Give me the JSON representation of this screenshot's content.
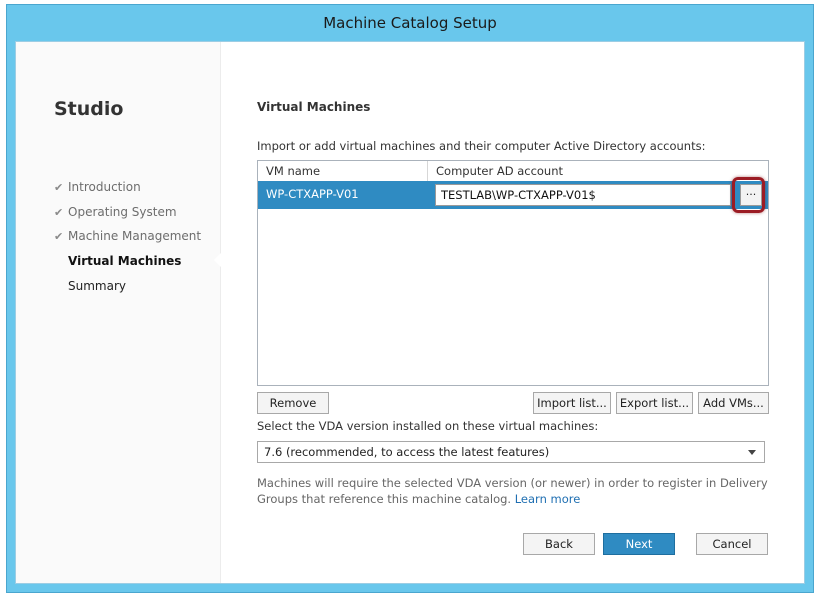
{
  "window": {
    "title": "Machine Catalog Setup"
  },
  "sidebar": {
    "heading": "Studio",
    "steps": [
      {
        "label": "Introduction",
        "state": "done"
      },
      {
        "label": "Operating System",
        "state": "done"
      },
      {
        "label": "Machine Management",
        "state": "done"
      },
      {
        "label": "Virtual Machines",
        "state": "current"
      },
      {
        "label": "Summary",
        "state": "future"
      }
    ],
    "check_glyph": "✔"
  },
  "main": {
    "title": "Virtual Machines",
    "instructions": "Import or add virtual machines and their computer Active Directory accounts:",
    "grid": {
      "columns": [
        "VM name",
        "Computer AD account"
      ],
      "rows": [
        {
          "vm_name": "WP-CTXAPP-V01",
          "ad_account": "TESTLAB\\WP-CTXAPP-V01$"
        }
      ],
      "browse_label": "..."
    },
    "buttons": {
      "remove": "Remove",
      "import": "Import list...",
      "export": "Export list...",
      "add": "Add VMs..."
    },
    "vda": {
      "label": "Select the VDA version installed on these virtual machines:",
      "selected": "7.6 (recommended, to access the latest features)"
    },
    "note": {
      "text": "Machines will require the selected VDA version (or newer) in order to register in Delivery Groups that reference this machine catalog.",
      "link": "Learn more"
    }
  },
  "footer": {
    "back": "Back",
    "next": "Next",
    "cancel": "Cancel"
  },
  "colors": {
    "title_bar": "#69c7ec",
    "selection": "#2f8bc2",
    "highlight_ring": "#9b1c24",
    "link": "#1f6fb2"
  }
}
